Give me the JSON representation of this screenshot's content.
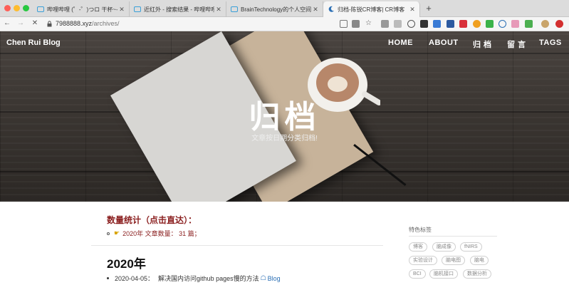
{
  "browser": {
    "tabs": [
      {
        "title": "哔哩哔哩 (゜-゜)つロ 干杯~-bili",
        "active": false
      },
      {
        "title": "近红外 - 搜索结果 - 哔哩哔哩弹",
        "active": false
      },
      {
        "title": "BrainTechnology的个人空间 - 哔",
        "active": false
      },
      {
        "title": "归档-陈锐CR博客| CR博客",
        "active": true
      }
    ],
    "new_tab": "+",
    "url_host": "7988888.xyz",
    "url_path": "/archives/"
  },
  "site": {
    "brand": "Chen Rui Blog",
    "nav": [
      "HOME",
      "ABOUT",
      "归 档",
      "留 言",
      "TAGS"
    ]
  },
  "hero": {
    "title": "归档",
    "subtitle": "文章按日期分类归档!"
  },
  "stats": {
    "title": "数量统计（点击直达）：",
    "item": "2020年 文章数量： 31 篇；"
  },
  "archive": {
    "year": "2020年",
    "post_date": "2020-04-05：",
    "post_title": "解决国内访问github pages慢的方法",
    "post_category": "Blog"
  },
  "sidebar": {
    "title": "特色标签",
    "tags": [
      "博客",
      "脑成像",
      "fNIRS",
      "实验设计",
      "脑电图",
      "脑电",
      "BCI",
      "脑机接口",
      "数据分析"
    ]
  }
}
